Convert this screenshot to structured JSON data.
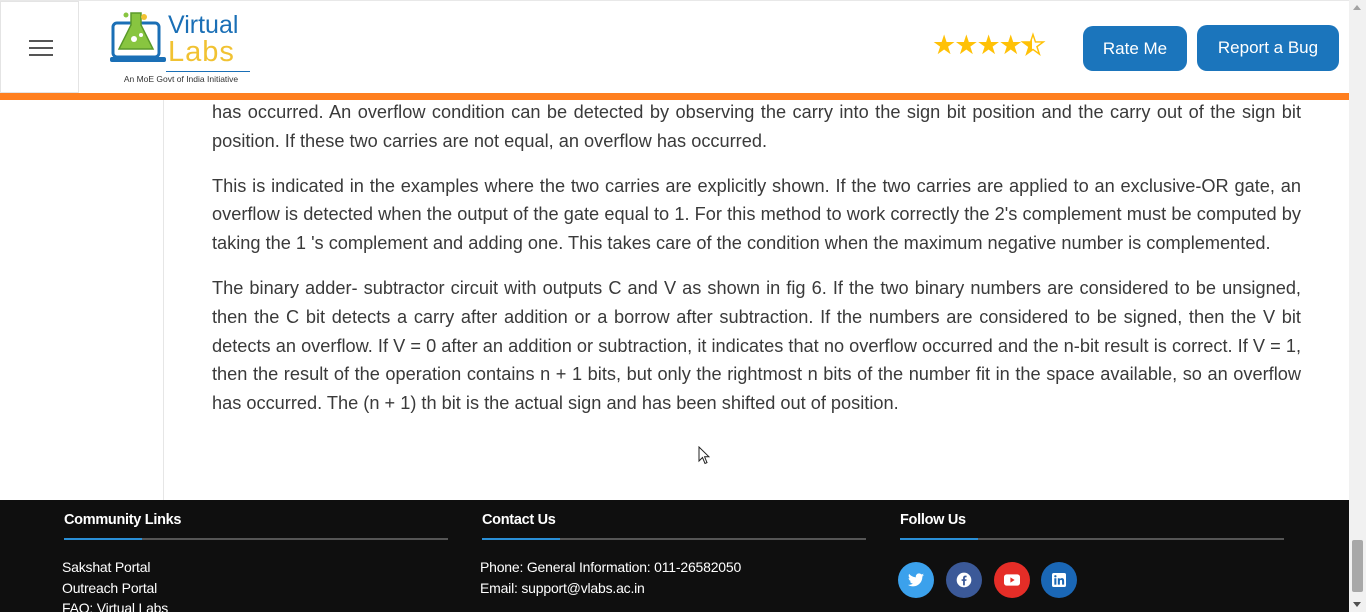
{
  "header": {
    "logo": {
      "word1": "Virtual",
      "word2": "Labs",
      "tagline": "An MoE Govt of India Initiative"
    },
    "rating_stars": 4.5,
    "rate_button": "Rate Me",
    "bug_button": "Report a Bug",
    "accent_color": "#ff7f1f",
    "button_color": "#1b75bc"
  },
  "content": {
    "paragraphs": [
      "has occurred. An overflow condition can be detected by observing the carry into the sign bit position and the carry out of the sign bit position. If these two carries are not equal, an overflow has occurred.",
      "This is indicated in the examples where the two carries are explicitly shown. If the two carries are applied to an exclusive-OR gate, an overflow is detected when the output of the gate equal to 1. For this method to work correctly the 2's complement must be computed by taking the 1 's complement and adding one. This takes care of the condition when the maximum negative number is complemented.",
      "The binary adder- subtractor circuit with outputs C and V as shown in fig 6. If the two binary numbers are considered to be unsigned, then the C bit detects a carry after addition or a borrow after subtraction. If the numbers are considered to be signed, then the V bit detects an overflow. If V = 0 after an addition or subtraction, it indicates that no overflow occurred and the n-bit result is correct. If V = 1, then the result of the operation contains n + 1 bits, but only the rightmost n bits of the number fit in the space available, so an overflow has occurred. The (n + 1) th bit is the actual sign and has been shifted out of position."
    ]
  },
  "footer": {
    "community": {
      "title": "Community Links",
      "links": [
        "Sakshat Portal",
        "Outreach Portal",
        "FAQ: Virtual Labs"
      ]
    },
    "contact": {
      "title": "Contact Us",
      "phone": "Phone: General Information: 011-26582050",
      "email": "Email: support@vlabs.ac.in"
    },
    "follow": {
      "title": "Follow Us",
      "icons": [
        {
          "name": "twitter-icon",
          "color": "#3ba1ec"
        },
        {
          "name": "facebook-icon",
          "color": "#3b5998"
        },
        {
          "name": "youtube-icon",
          "color": "#e52d27"
        },
        {
          "name": "linkedin-icon",
          "color": "#1a67b6"
        }
      ]
    }
  }
}
